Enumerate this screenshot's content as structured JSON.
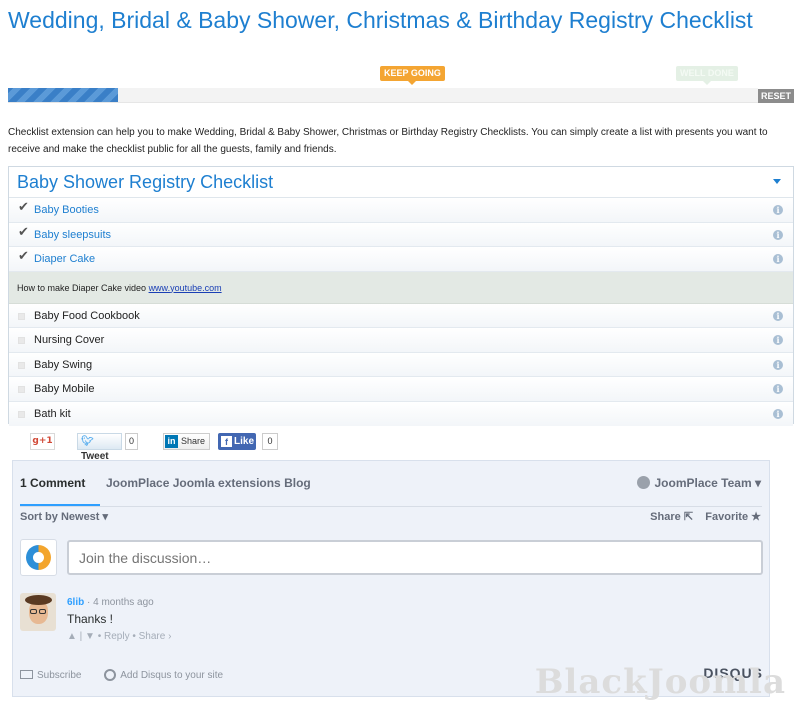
{
  "page_title": "Wedding, Bridal & Baby Shower, Christmas & Birthday Registry Checklist",
  "progress": {
    "fraction": 0.147,
    "keep_going_label": "KEEP GOING",
    "well_done_label": "WELL DONE",
    "reset_label": "RESET",
    "colors": {
      "fill": "#3a7fc7",
      "keep_going": "#f4a532",
      "reset": "#8c8c8c"
    }
  },
  "intro_text": "Checklist extension can help you to make Wedding, Bridal & Baby Shower, Christmas or Birthday Registry Checklists. You can simply create a list with presents you want to receive and make the checklist public for all the guests, family and friends.",
  "checklist": {
    "title": "Baby Shower Registry Checklist",
    "items_done": [
      {
        "label": "Baby Booties"
      },
      {
        "label": "Baby sleepsuits"
      },
      {
        "label": "Diaper Cake"
      }
    ],
    "note": {
      "text": "How to make Diaper Cake video ",
      "link_text": "www.youtube.com"
    },
    "items_todo": [
      {
        "label": "Baby Food Cookbook"
      },
      {
        "label": "Nursing Cover"
      },
      {
        "label": "Baby Swing"
      },
      {
        "label": "Baby Mobile"
      },
      {
        "label": "Bath kit"
      }
    ]
  },
  "social": {
    "gplus": "g+1",
    "tweet": "Tweet",
    "tweet_count": "0",
    "linkedin_mark": "in",
    "linkedin": "Share",
    "fb_mark": "f",
    "fb_like": "Like",
    "fb_count": "0"
  },
  "disqus": {
    "tab_comments": "1 Comment",
    "tab_blog": "JoomPlace Joomla extensions Blog",
    "user": "JoomPlace Team ▾",
    "sort": "Sort by Newest ▾",
    "share": "Share",
    "favorite": "Favorite",
    "join_placeholder": "Join the discussion…",
    "comment": {
      "author": "6lib",
      "time": "4 months ago",
      "body": "Thanks !",
      "actions": "▲ | ▼ • Reply • Share ›"
    },
    "subscribe": "Subscribe",
    "add_disqus": "Add Disqus to your site",
    "brand": "DISQUS"
  },
  "watermark": "BlackJoomla"
}
